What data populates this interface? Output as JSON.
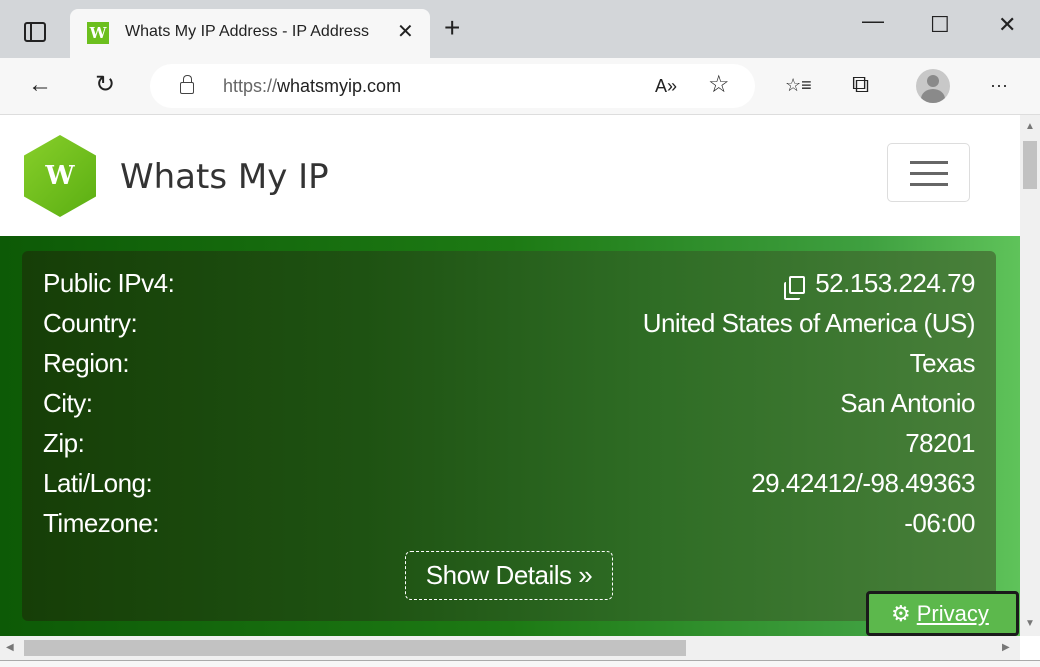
{
  "browser": {
    "tab_title": "Whats My IP Address - IP Address",
    "favicon_letter": "W",
    "url_prefix": "https://",
    "url_host": "whatsmyip.com",
    "new_tab": "+",
    "tab_close": "✕",
    "minimize": "—",
    "maximize": "☐",
    "close": "✕",
    "back": "←",
    "refresh": "↻",
    "read_aloud": "A»",
    "add_favorite": "☆",
    "favorites": "☆≡",
    "collections": "⧉",
    "more": "···"
  },
  "site": {
    "logo_letter": "W",
    "brand": "Whats My IP",
    "accent": "#5cb84c"
  },
  "info": {
    "rows": [
      {
        "label": "Public IPv4:",
        "value": "52.153.224.79"
      },
      {
        "label": "Country:",
        "value": "United States of America (US)"
      },
      {
        "label": "Region:",
        "value": "Texas"
      },
      {
        "label": "City:",
        "value": "San Antonio"
      },
      {
        "label": "Zip:",
        "value": "78201"
      },
      {
        "label": "Lati/Long:",
        "value": "29.42412/-98.49363"
      },
      {
        "label": "Timezone:",
        "value": "-06:00"
      }
    ],
    "show_details": "Show Details »"
  },
  "privacy": {
    "icon": "⚙",
    "label": "Privacy"
  }
}
